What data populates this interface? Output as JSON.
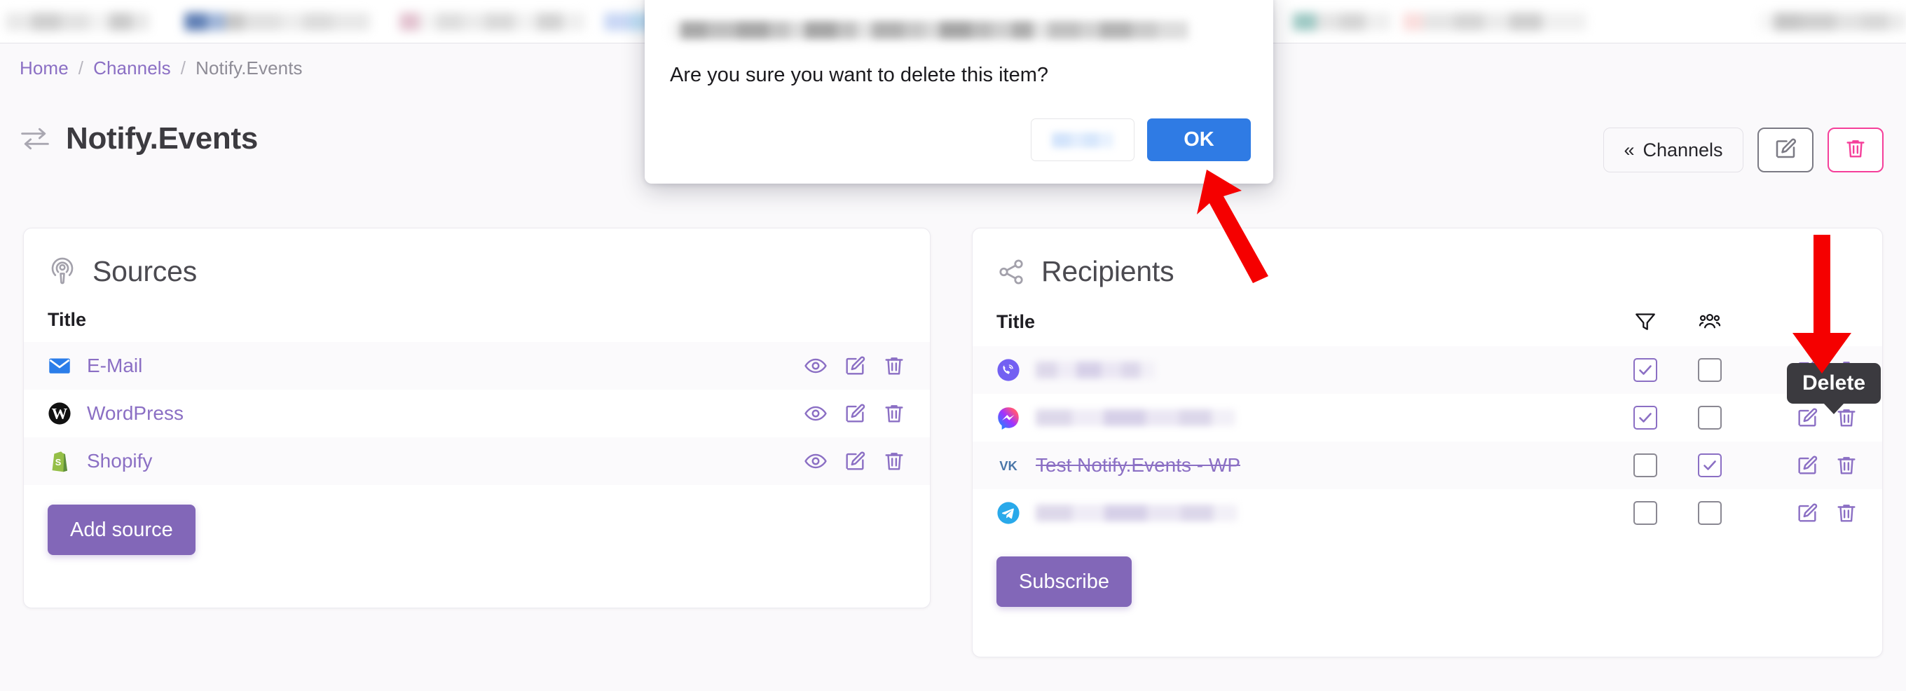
{
  "breadcrumb": {
    "home": "Home",
    "channels": "Channels",
    "current": "Notify.Events",
    "separator": "/"
  },
  "page": {
    "title": "Notify.Events",
    "title_icon": "exchange-arrows-icon"
  },
  "top_actions": {
    "back_chevron": "«",
    "back_label": "Channels",
    "edit_icon": "pencil-square-icon",
    "delete_icon": "trash-icon"
  },
  "sources": {
    "icon": "podcast-broadcast-icon",
    "title": "Sources",
    "column_title": "Title",
    "rows": [
      {
        "icon": "email-icon",
        "label": "E-Mail",
        "actions": [
          "view-icon",
          "edit-icon",
          "delete-icon"
        ]
      },
      {
        "icon": "wordpress-icon",
        "label": "WordPress",
        "actions": [
          "view-icon",
          "edit-icon",
          "delete-icon"
        ]
      },
      {
        "icon": "shopify-icon",
        "label": "Shopify",
        "actions": [
          "view-icon",
          "edit-icon",
          "delete-icon"
        ]
      }
    ],
    "add_button": "Add source"
  },
  "recipients": {
    "icon": "share-nodes-icon",
    "title": "Recipients",
    "column_title": "Title",
    "column_filter_icon": "funnel-filter-icon",
    "column_group_icon": "users-group-icon",
    "rows": [
      {
        "icon": "viber-icon",
        "label": "",
        "redacted": true,
        "struck": false,
        "filter_checked": true,
        "group_checked": false,
        "redact_width": 170
      },
      {
        "icon": "messenger-icon",
        "label": "",
        "redacted": true,
        "struck": false,
        "filter_checked": true,
        "group_checked": false,
        "redact_width": 285
      },
      {
        "icon": "vk-icon",
        "label": "Test Notify.Events - WP",
        "redacted": false,
        "struck": true,
        "filter_checked": false,
        "group_checked": true,
        "redact_width": 0
      },
      {
        "icon": "telegram-icon",
        "label": "",
        "redacted": true,
        "struck": false,
        "filter_checked": false,
        "group_checked": false,
        "redact_width": 288
      }
    ],
    "subscribe_button": "Subscribe"
  },
  "tooltip": {
    "text": "Delete"
  },
  "dialog": {
    "title_redacted": true,
    "message": "Are you sure you want to delete this item?",
    "cancel_label": "",
    "cancel_redacted": true,
    "ok_label": "OK"
  },
  "colors": {
    "accent_purple": "#8b6fc4",
    "primary_button": "#8267b8",
    "danger_pink": "#f53f9a",
    "dialog_ok_blue": "#2f7be4",
    "annotation_red": "#f50000",
    "page_background": "#faf9fb"
  }
}
